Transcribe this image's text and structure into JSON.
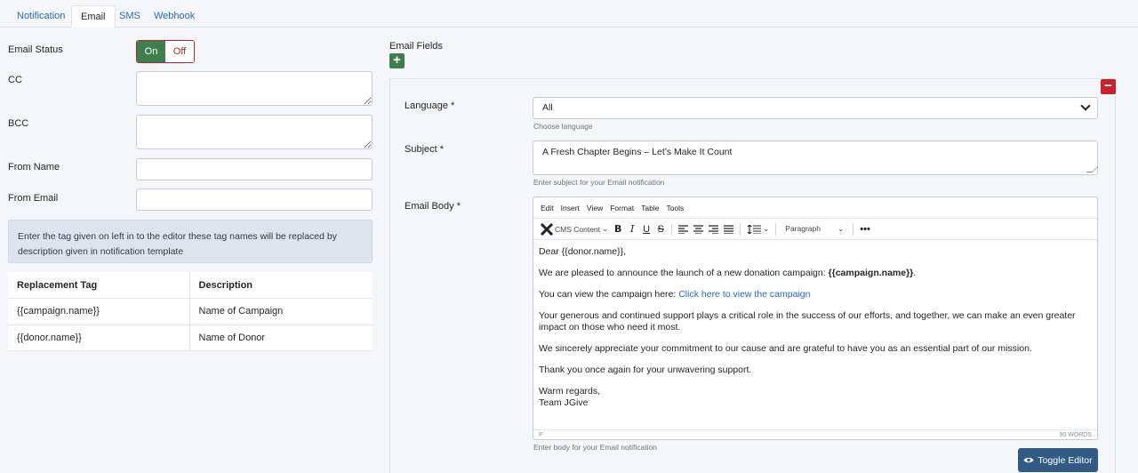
{
  "tabs": [
    {
      "label": "Notification"
    },
    {
      "label": "Email"
    },
    {
      "label": "SMS"
    },
    {
      "label": "Webhook"
    }
  ],
  "left": {
    "email_status_label": "Email Status",
    "toggle_on": "On",
    "toggle_off": "Off",
    "cc_label": "CC",
    "bcc_label": "BCC",
    "from_name_label": "From Name",
    "from_email_label": "From Email",
    "info_text": "Enter the tag given on left in to the editor these tag names will be replaced by description given in notification template",
    "table": {
      "headers": [
        "Replacement Tag",
        "Description"
      ],
      "rows": [
        [
          "{{campaign.name}}",
          "Name of Campaign"
        ],
        [
          "{{donor.name}}",
          "Name of Donor"
        ]
      ]
    }
  },
  "right": {
    "email_fields_label": "Email Fields",
    "add_icon": "+",
    "remove_icon": "−",
    "language_label": "Language *",
    "language_value": "All",
    "language_help": "Choose language",
    "subject_label": "Subject *",
    "subject_value": "A Fresh Chapter Begins – Let’s Make It Count",
    "subject_help": "Enter subject for your Email notification",
    "body_label": "Email Body *",
    "menu": [
      "Edit",
      "Insert",
      "View",
      "Format",
      "Table",
      "Tools"
    ],
    "cms_content": "CMS Content",
    "paragraph": "Paragraph",
    "body": {
      "p1": "Dear {{donor.name}},",
      "p2_text": "We are pleased to announce the launch of a new donation campaign: ",
      "p2_bold": "{{campaign.name}}",
      "p2_end": ".",
      "p3_text": "You can view the campaign here: ",
      "p3_link": "Click here to view the campaign",
      "p4": "Your generous and continued support plays a critical role in the success of our efforts, and together, we can make an even greater impact on those who need it most.",
      "p5": "We sincerely appreciate your commitment to our cause and are grateful to have you as an essential part of our mission.",
      "p6": "Thank you once again for your unwavering support.",
      "p7a": "Warm regards,",
      "p7b": "Team JGive"
    },
    "status_path": "P",
    "word_count": "90 WORDS",
    "body_help": "Enter body for your Email notification",
    "toggle_editor": "Toggle Editor"
  },
  "colors": {
    "green": "#3f7f4d",
    "red": "#c8232c",
    "link": "#2a69b8",
    "button_dark": "#325a86"
  }
}
